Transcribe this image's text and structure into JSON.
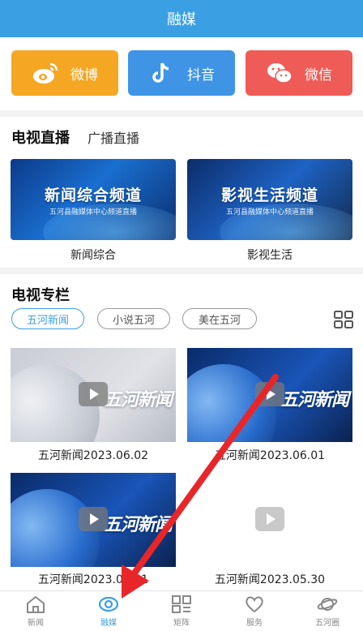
{
  "header": {
    "title": "融媒"
  },
  "social": [
    {
      "label": "微博",
      "icon": "weibo-icon",
      "color": "#f5a623"
    },
    {
      "label": "抖音",
      "icon": "douyin-icon",
      "color": "#3f94e6"
    },
    {
      "label": "微信",
      "icon": "wechat-icon",
      "color": "#ef5b57"
    }
  ],
  "tv": {
    "tabs": [
      "电视直播",
      "广播直播"
    ],
    "channels": [
      {
        "banner": "新闻综合频道",
        "sub": "五河县融媒体中心频道直播",
        "label": "新闻综合"
      },
      {
        "banner": "影视生活频道",
        "sub": "五河县融媒体中心频道直播",
        "label": "影视生活"
      }
    ]
  },
  "column": {
    "title": "电视专栏",
    "pills": [
      "五河新闻",
      "小说五河",
      "美在五河"
    ],
    "videos": [
      {
        "title": "五河新闻2023.06.02",
        "thumb_text": "五河新闻"
      },
      {
        "title": "五河新闻2023.06.01",
        "thumb_text": "五河新闻"
      },
      {
        "title": "五河新闻2023.05.31",
        "thumb_text": "五河新闻"
      },
      {
        "title": "五河新闻2023.05.30",
        "thumb_text": ""
      }
    ]
  },
  "bottom_nav": [
    {
      "label": "新闻",
      "icon": "home-icon"
    },
    {
      "label": "融媒",
      "icon": "eye-icon",
      "active": true
    },
    {
      "label": "矩阵",
      "icon": "grid-icon"
    },
    {
      "label": "服务",
      "icon": "heart-icon"
    },
    {
      "label": "五河圈",
      "icon": "planet-icon"
    }
  ],
  "accent_color": "#3b9fe3",
  "annotation_color": "#e8262a"
}
